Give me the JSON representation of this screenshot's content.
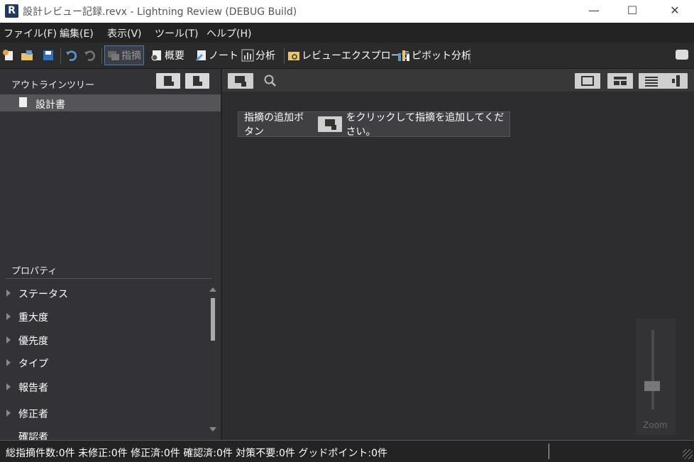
{
  "window": {
    "app_icon": "R",
    "title": "設計レビュー記録.revx  - Lightning Review (DEBUG Build)",
    "minimize": "—",
    "maximize": "☐",
    "close": "✕"
  },
  "menu": [
    "ファイル(F)",
    "編集(E)",
    "表示(V)",
    "ツール(T)",
    "ヘルプ(H)"
  ],
  "toolbar": {
    "new_icon": "new-file-icon",
    "open_icon": "open-folder-icon",
    "save_icon": "save-icon",
    "undo_icon": "undo-icon",
    "redo_icon": "redo-icon",
    "remarks": "指摘",
    "overview": "概要",
    "note": "ノート",
    "analysis": "分析",
    "review_explorer": "レビューエクスプローラ",
    "pivot_analysis": "ピボット分析"
  },
  "outline": {
    "header": "アウトラインツリー",
    "items": [
      "設計書"
    ]
  },
  "properties": {
    "header": "プロパティ",
    "items": [
      "ステータス",
      "重大度",
      "優先度",
      "タイプ",
      "報告者",
      "修正者",
      "確認者"
    ]
  },
  "hint": {
    "before": "指摘の追加ボタン",
    "after": "をクリックして指摘を追加してください。"
  },
  "zoom": {
    "label": "Zoom",
    "level": 0.25
  },
  "status": {
    "text": "総指摘件数:0件  未修正:0件  修正済:0件  確認済:0件  対策不要:0件  グッドポイント:0件"
  },
  "colors": {
    "accent": "#4a7bb0",
    "background": "#2d2d30"
  }
}
